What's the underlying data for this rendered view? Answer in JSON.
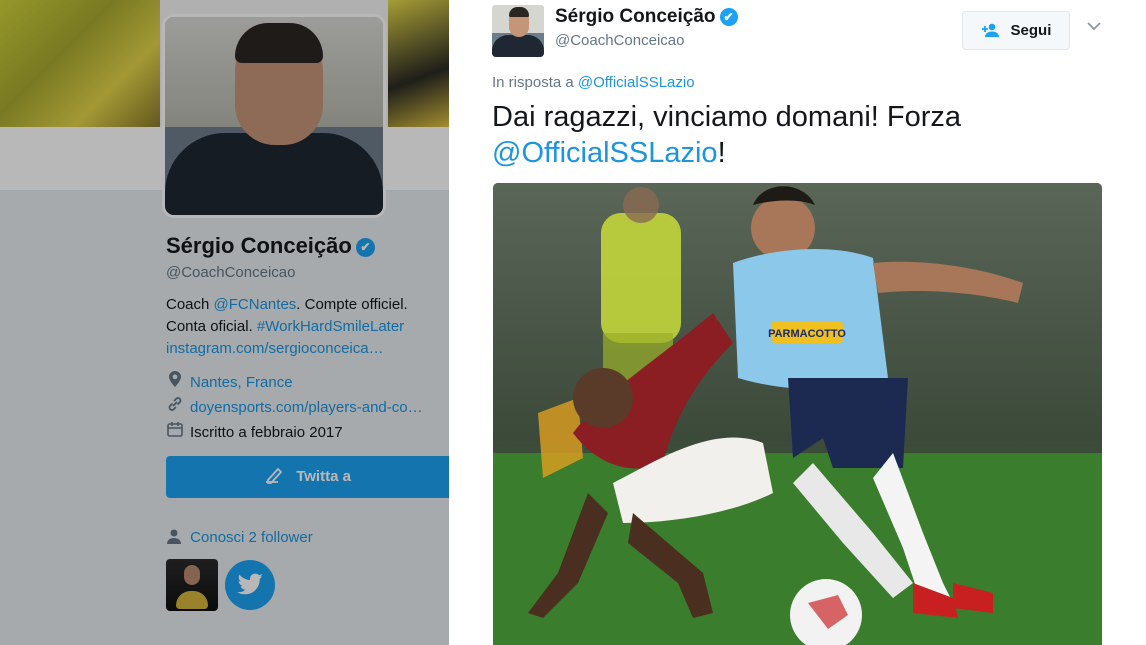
{
  "profile": {
    "name": "Sérgio Conceição",
    "verified_mark": "✔",
    "handle": "@CoachConceicao",
    "bio_line1_prefix": "Coach ",
    "bio_line1_link": "@FCNantes",
    "bio_line1_suffix": ". Compte officiel.",
    "bio_line2_prefix": "Conta oficial. ",
    "bio_line2_link": "#WorkHardSmileLater",
    "bio_line3_link": "instagram.com/sergioconceica…",
    "location": "Nantes, France",
    "website": "doyensports.com/players-and-co…",
    "joined": "Iscritto a febbraio 2017",
    "tweet_to_label": "Twitta a",
    "followers_known": "Conosci 2 follower",
    "icons": {
      "location": "location-pin-icon",
      "link": "link-icon",
      "calendar": "calendar-icon",
      "compose": "compose-icon",
      "user": "user-icon",
      "twitter": "twitter-bird-icon"
    }
  },
  "tweet": {
    "author_name": "Sérgio Conceição",
    "author_handle": "@CoachConceicao",
    "follow_label": "Segui",
    "reply_prefix": "In risposta a ",
    "reply_to": "@OfficialSSLazio",
    "text_main": "Dai ragazzi, vinciamo domani! Forza ",
    "text_mention": "@OfficialSSLazio",
    "text_end": "!",
    "photo_sponsor": "PARMACOTTO"
  },
  "colors": {
    "accent": "#1da1f2",
    "link": "#1b95e0",
    "text": "#14171a",
    "muted": "#657786"
  }
}
